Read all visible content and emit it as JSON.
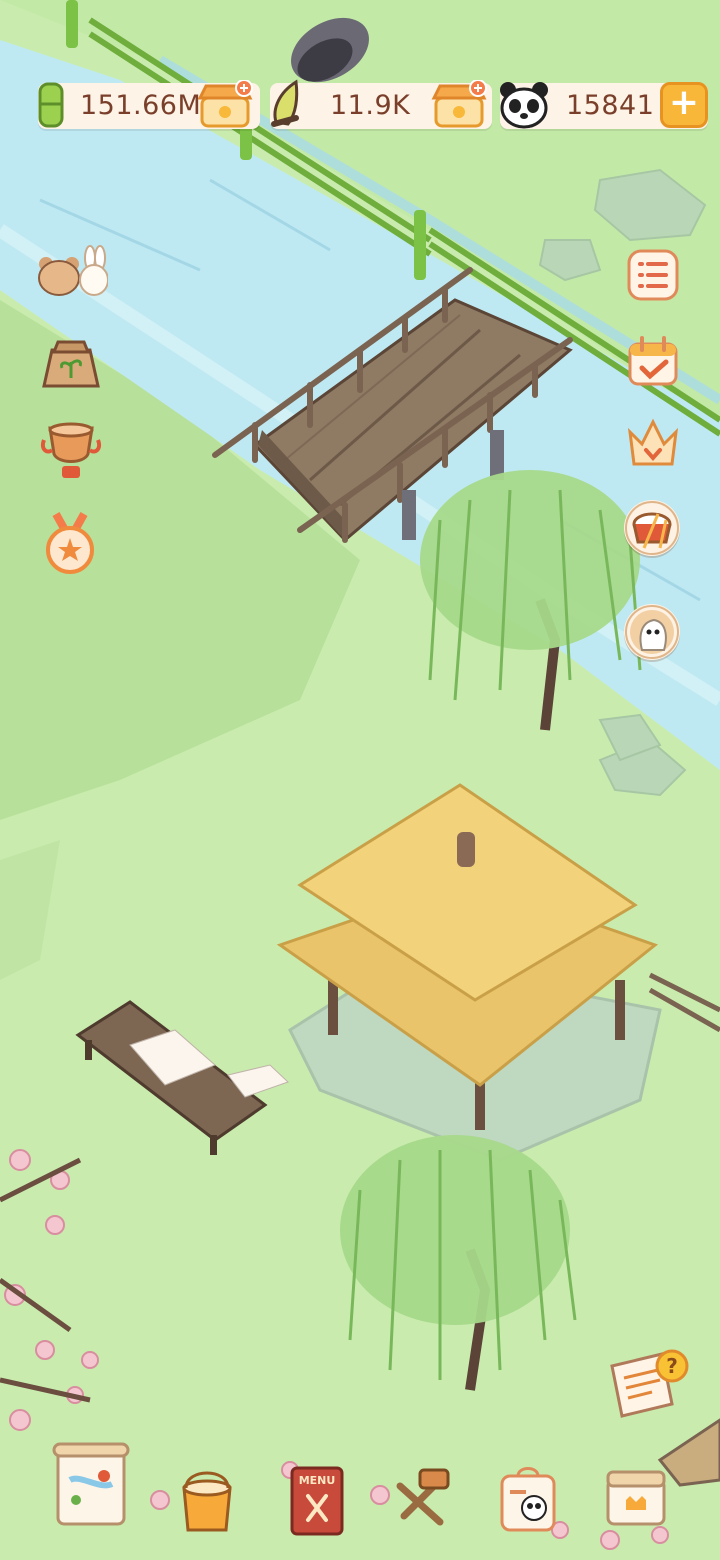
{
  "hud": {
    "bamboo": {
      "icon": "bamboo-stalk-icon",
      "value": "151.66M"
    },
    "shoots": {
      "icon": "bamboo-shoot-icon",
      "value": "11.9K"
    },
    "pandas": {
      "icon": "panda-face-icon",
      "value": "15841"
    },
    "shop_icon": "shop-stall-icon",
    "add_icon": "plus-icon"
  },
  "side_left": [
    {
      "name": "friends-button",
      "icon": "bear-rabbit-icon"
    },
    {
      "name": "seed-bag-button",
      "icon": "seed-bag-icon"
    },
    {
      "name": "trophy-button",
      "icon": "trophy-icon"
    },
    {
      "name": "medal-button",
      "icon": "star-medal-icon"
    }
  ],
  "side_right": [
    {
      "name": "task-list-button",
      "icon": "list-icon"
    },
    {
      "name": "daily-checkin-button",
      "icon": "calendar-check-icon"
    },
    {
      "name": "crown-button",
      "icon": "crown-icon"
    },
    {
      "name": "music-button",
      "icon": "drum-music-icon"
    },
    {
      "name": "visitor-button",
      "icon": "ghost-visitor-icon"
    }
  ],
  "bottom_bar": [
    {
      "name": "map-button",
      "icon": "map-scroll-icon"
    },
    {
      "name": "paint-button",
      "icon": "paint-bucket-icon"
    },
    {
      "name": "menu-button",
      "icon": "menu-book-icon",
      "label": "MENU"
    },
    {
      "name": "tools-button",
      "icon": "tools-icon"
    },
    {
      "name": "panda-card-button",
      "icon": "panda-card-icon"
    },
    {
      "name": "storage-button",
      "icon": "storage-box-icon"
    }
  ],
  "notepad": {
    "icon": "help-notepad-icon",
    "badge": "?"
  },
  "colors": {
    "grass": "#c9ecae",
    "river": "#bfe9f2",
    "text": "#7a3f2a",
    "accent": "#f9b73a"
  }
}
